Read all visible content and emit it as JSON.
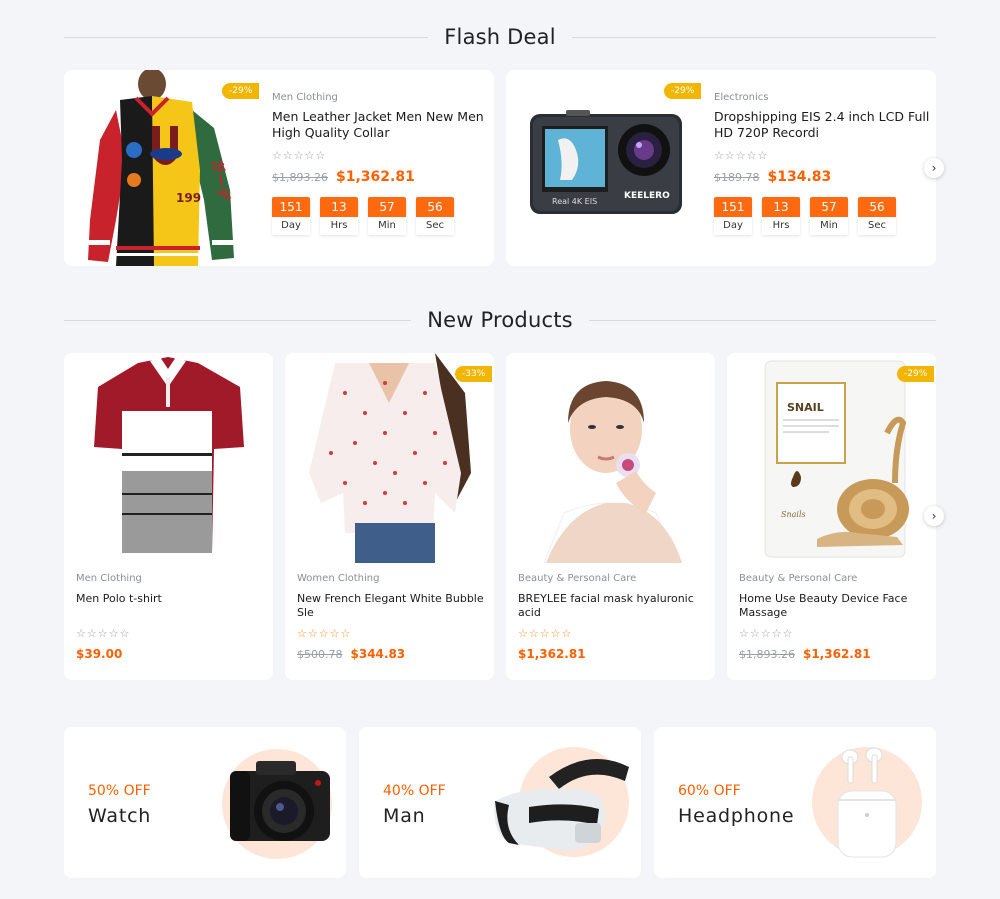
{
  "flash_deal": {
    "title": "Flash Deal",
    "items": [
      {
        "badge": "-29%",
        "category": "Men Clothing",
        "name": "Men Leather Jacket Men New Men High Quality Collar",
        "old_price": "$1,893.26",
        "price": "$1,362.81",
        "timer": [
          {
            "value": "151",
            "unit": "Day"
          },
          {
            "value": "13",
            "unit": "Hrs"
          },
          {
            "value": "57",
            "unit": "Min"
          },
          {
            "value": "56",
            "unit": "Sec"
          }
        ]
      },
      {
        "badge": "-29%",
        "category": "Electronics",
        "name": "Dropshipping EIS 2.4 inch LCD Full HD 720P Recordi",
        "old_price": "$189.78",
        "price": "$134.83",
        "camera_text": "Real 4K EIS",
        "camera_brand": "KEELERO",
        "timer": [
          {
            "value": "151",
            "unit": "Day"
          },
          {
            "value": "13",
            "unit": "Hrs"
          },
          {
            "value": "57",
            "unit": "Min"
          },
          {
            "value": "56",
            "unit": "Sec"
          }
        ]
      }
    ],
    "next_icon": "chevron-right"
  },
  "new_products": {
    "title": "New Products",
    "items": [
      {
        "category": "Men Clothing",
        "name": "Men Polo t-shirt",
        "old_price": "",
        "price": "$39.00",
        "badge": "",
        "rating_color": "grey"
      },
      {
        "category": "Women Clothing",
        "name": "New French Elegant White Bubble Sle",
        "old_price": "$500.78",
        "price": "$344.83",
        "badge": "-33%",
        "rating_color": "orange"
      },
      {
        "category": "Beauty & Personal Care",
        "name": "BREYLEE facial mask hyaluronic acid",
        "old_price": "",
        "price": "$1,362.81",
        "badge": "",
        "rating_color": "orange"
      },
      {
        "category": "Beauty & Personal Care",
        "name": "Home Use Beauty Device Face Massage",
        "old_price": "$1,893.26",
        "price": "$1,362.81",
        "badge": "-29%",
        "rating_color": "grey",
        "pack_title": "SNAIL",
        "pack_sub": "Snails"
      }
    ],
    "next_icon": "chevron-right"
  },
  "banners": [
    {
      "discount": "50% OFF",
      "name": "Watch",
      "image": "camera"
    },
    {
      "discount": "40% OFF",
      "name": "Man",
      "image": "vr-headset"
    },
    {
      "discount": "60% OFF",
      "name": "Headphone",
      "image": "earbuds"
    }
  ],
  "stars": "☆☆☆☆☆",
  "colors": {
    "accent": "#ff6000",
    "badge": "#f2b600",
    "background": "#f4f5f8"
  }
}
